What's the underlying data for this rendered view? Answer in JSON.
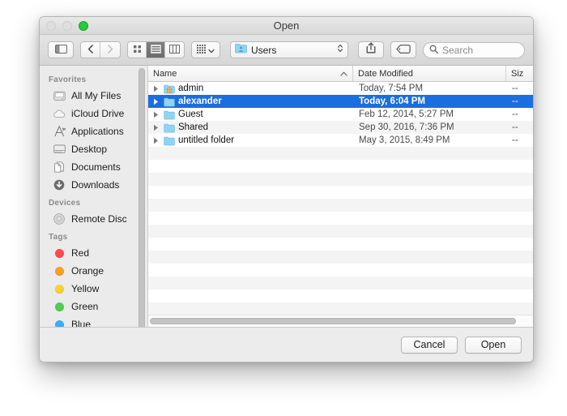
{
  "window": {
    "title": "Open",
    "controls": [
      {
        "name": "close-button",
        "color": "#dedede",
        "enabled": false
      },
      {
        "name": "minimize-button",
        "color": "#dedede",
        "enabled": false
      },
      {
        "name": "zoom-button",
        "color": "#27c93f",
        "enabled": true
      }
    ]
  },
  "toolbar": {
    "sidebar_toggle_icon": "sidebar-toggle-icon",
    "back_icon": "chevron-left-icon",
    "forward_icon": "chevron-right-icon",
    "view_icon_grid": "icon-view-icon",
    "view_list": "list-view-icon",
    "view_columns": "column-view-icon",
    "arrange_icon": "arrange-by-icon",
    "arrange_chevron": "chevron-down-icon",
    "path_label": "Users",
    "path_icon": "users-folder-icon",
    "path_chevron": "up-down-chevron-icon",
    "share_icon": "share-icon",
    "tag_icon": "tag-icon",
    "search_icon": "search-icon",
    "search_placeholder": "Search",
    "search_value": ""
  },
  "sidebar": {
    "sections": [
      {
        "heading": "Favorites",
        "items": [
          {
            "label": "All My Files",
            "icon": "all-my-files-icon"
          },
          {
            "label": "iCloud Drive",
            "icon": "icloud-drive-icon"
          },
          {
            "label": "Applications",
            "icon": "applications-icon"
          },
          {
            "label": "Desktop",
            "icon": "desktop-icon"
          },
          {
            "label": "Documents",
            "icon": "documents-icon"
          },
          {
            "label": "Downloads",
            "icon": "downloads-icon"
          }
        ]
      },
      {
        "heading": "Devices",
        "items": [
          {
            "label": "Remote Disc",
            "icon": "remote-disc-icon"
          }
        ]
      },
      {
        "heading": "Tags",
        "items": [
          {
            "label": "Red",
            "icon": "tag-dot-icon",
            "color": "#fc4b4b"
          },
          {
            "label": "Orange",
            "icon": "tag-dot-icon",
            "color": "#f99f27"
          },
          {
            "label": "Yellow",
            "icon": "tag-dot-icon",
            "color": "#f7d232"
          },
          {
            "label": "Green",
            "icon": "tag-dot-icon",
            "color": "#52cc52"
          },
          {
            "label": "Blue",
            "icon": "tag-dot-icon",
            "color": "#3dacf0"
          }
        ]
      }
    ]
  },
  "file_list": {
    "columns": [
      {
        "label": "Name",
        "sorted": true,
        "sort_direction": "ascending"
      },
      {
        "label": "Date Modified",
        "sorted": false
      },
      {
        "label": "Siz",
        "sorted": false
      }
    ],
    "rows": [
      {
        "name": "admin",
        "date": "Today, 7:54 PM",
        "size": "--",
        "icon": "home-folder-icon",
        "selected": false,
        "expandable": true
      },
      {
        "name": "alexander",
        "date": "Today, 6:04 PM",
        "size": "--",
        "icon": "folder-icon",
        "selected": true,
        "expandable": true
      },
      {
        "name": "Guest",
        "date": "Feb 12, 2014, 5:27 PM",
        "size": "--",
        "icon": "folder-icon",
        "selected": false,
        "expandable": true
      },
      {
        "name": "Shared",
        "date": "Sep 30, 2016, 7:36 PM",
        "size": "--",
        "icon": "folder-icon",
        "selected": false,
        "expandable": true
      },
      {
        "name": "untitled folder",
        "date": "May 3, 2015, 8:49 PM",
        "size": "--",
        "icon": "folder-icon",
        "selected": false,
        "expandable": true
      }
    ],
    "empty_row_count": 13,
    "selection_color": "#1a6ee0"
  },
  "footer": {
    "cancel_label": "Cancel",
    "open_label": "Open"
  }
}
